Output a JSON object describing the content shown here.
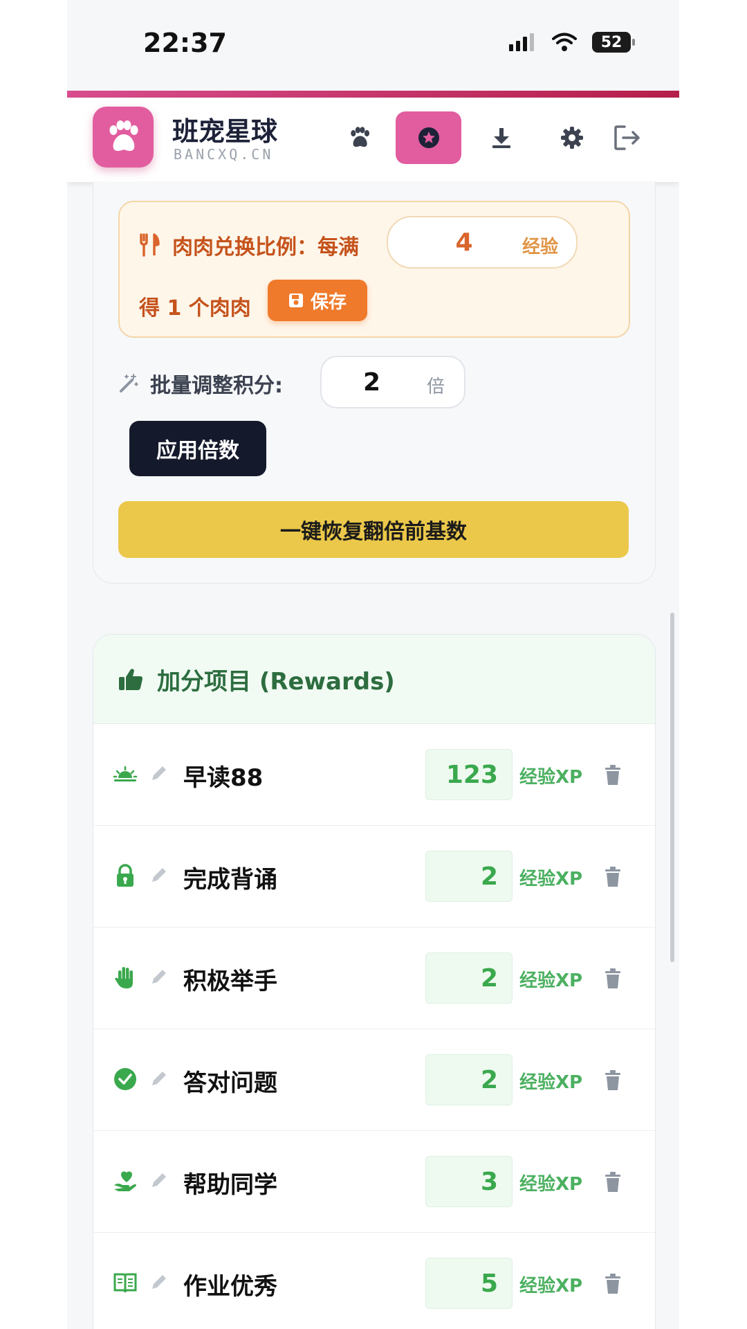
{
  "status": {
    "time": "22:37",
    "battery": "52"
  },
  "header": {
    "title": "班宠星球",
    "subtitle": "BANCXQ.CN"
  },
  "exchange": {
    "label": "肉肉兑换比例：每满",
    "value": "4",
    "unit": "经验",
    "line2": "得 1 个肉肉",
    "save_label": "保存"
  },
  "batch": {
    "label": "批量调整积分:",
    "value": "2",
    "unit": "倍",
    "apply_label": "应用倍数",
    "restore_label": "一键恢复翻倍前基数"
  },
  "rewards": {
    "title": "加分项目 (Rewards)",
    "items": [
      {
        "icon": "sunrise-icon",
        "label": "早读88",
        "value": "123",
        "unit": "经验XP"
      },
      {
        "icon": "lock-icon",
        "label": "完成背诵",
        "value": "2",
        "unit": "经验XP"
      },
      {
        "icon": "hand-icon",
        "label": "积极举手",
        "value": "2",
        "unit": "经验XP"
      },
      {
        "icon": "check-circle-icon",
        "label": "答对问题",
        "value": "2",
        "unit": "经验XP"
      },
      {
        "icon": "helping-heart-icon",
        "label": "帮助同学",
        "value": "3",
        "unit": "经验XP"
      },
      {
        "icon": "book-icon",
        "label": "作业优秀",
        "value": "5",
        "unit": "经验XP"
      }
    ]
  },
  "colors": {
    "brand": "#e15d9f",
    "orange": "#ef7a2b",
    "green": "#3aa84d",
    "dark": "#141a2b",
    "yellow": "#ebc84a"
  }
}
